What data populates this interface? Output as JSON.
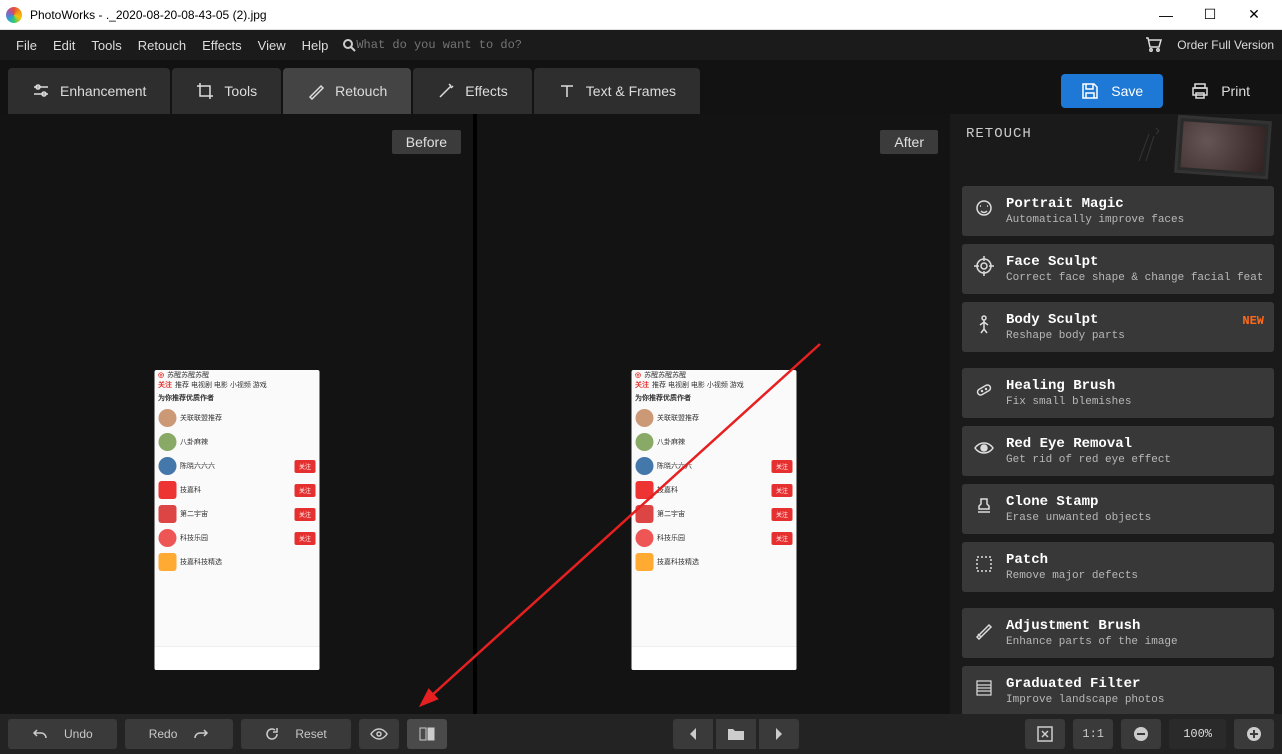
{
  "window": {
    "app_name": "PhotoWorks",
    "file_name": "._2020-08-20-08-43-05 (2).jpg"
  },
  "menu": {
    "file": "File",
    "edit": "Edit",
    "tools": "Tools",
    "retouch": "Retouch",
    "effects": "Effects",
    "view": "View",
    "help": "Help",
    "search_placeholder": "What do you want to do?",
    "order": "Order Full Version"
  },
  "tabs": {
    "enhancement": "Enhancement",
    "tools": "Tools",
    "retouch": "Retouch",
    "effects": "Effects",
    "text_frames": "Text & Frames"
  },
  "actions": {
    "save": "Save",
    "print": "Print"
  },
  "viewport": {
    "before": "Before",
    "after": "After"
  },
  "panel": {
    "title": "RETOUCH",
    "groups": [
      [
        {
          "title": "Portrait Magic",
          "desc": "Automatically improve faces",
          "icon": "face"
        },
        {
          "title": "Face Sculpt",
          "desc": "Correct face shape & change facial features",
          "icon": "target"
        },
        {
          "title": "Body Sculpt",
          "desc": "Reshape body parts",
          "icon": "body",
          "badge": "NEW"
        }
      ],
      [
        {
          "title": "Healing Brush",
          "desc": "Fix small blemishes",
          "icon": "bandage"
        },
        {
          "title": "Red Eye Removal",
          "desc": "Get rid of red eye effect",
          "icon": "eye"
        },
        {
          "title": "Clone Stamp",
          "desc": "Erase unwanted objects",
          "icon": "stamp"
        },
        {
          "title": "Patch",
          "desc": "Remove major defects",
          "icon": "patch"
        }
      ],
      [
        {
          "title": "Adjustment Brush",
          "desc": "Enhance parts of the image",
          "icon": "brush"
        },
        {
          "title": "Graduated Filter",
          "desc": "Improve landscape photos",
          "icon": "grad"
        }
      ]
    ]
  },
  "statusbar": {
    "undo": "Undo",
    "redo": "Redo",
    "reset": "Reset",
    "ratio": "1:1",
    "zoom": "100%"
  }
}
